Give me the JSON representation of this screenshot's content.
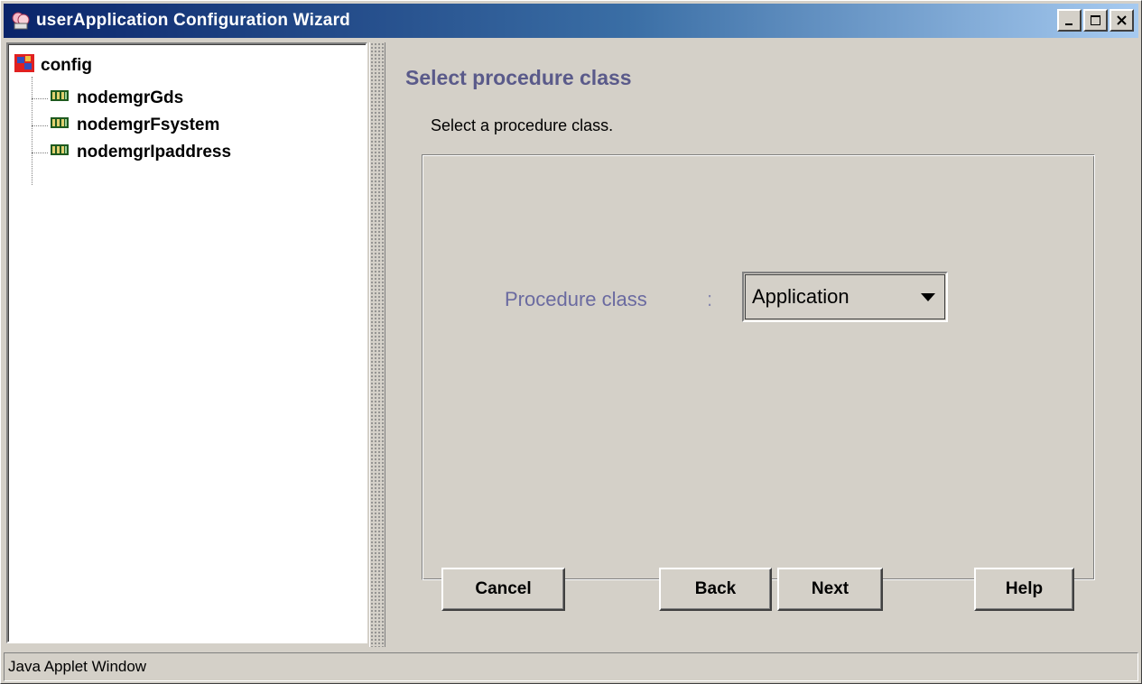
{
  "window": {
    "title": "userApplication Configuration Wizard",
    "buttons": [
      "minimize",
      "maximize",
      "close"
    ]
  },
  "tree": {
    "root": {
      "label": "config",
      "icon": "config-icon"
    },
    "children": [
      {
        "label": "nodemgrGds",
        "icon": "resource-icon"
      },
      {
        "label": "nodemgrFsystem",
        "icon": "resource-icon"
      },
      {
        "label": "nodemgrIpaddress",
        "icon": "resource-icon"
      }
    ]
  },
  "step": {
    "title": "Select procedure class",
    "description": "Select a procedure class."
  },
  "form": {
    "procedure_class_label": "Procedure class",
    "colon": ":",
    "procedure_class_value": "Application"
  },
  "buttons": {
    "cancel": "Cancel",
    "back": "Back",
    "next": "Next",
    "help": "Help"
  },
  "status": "Java Applet Window"
}
